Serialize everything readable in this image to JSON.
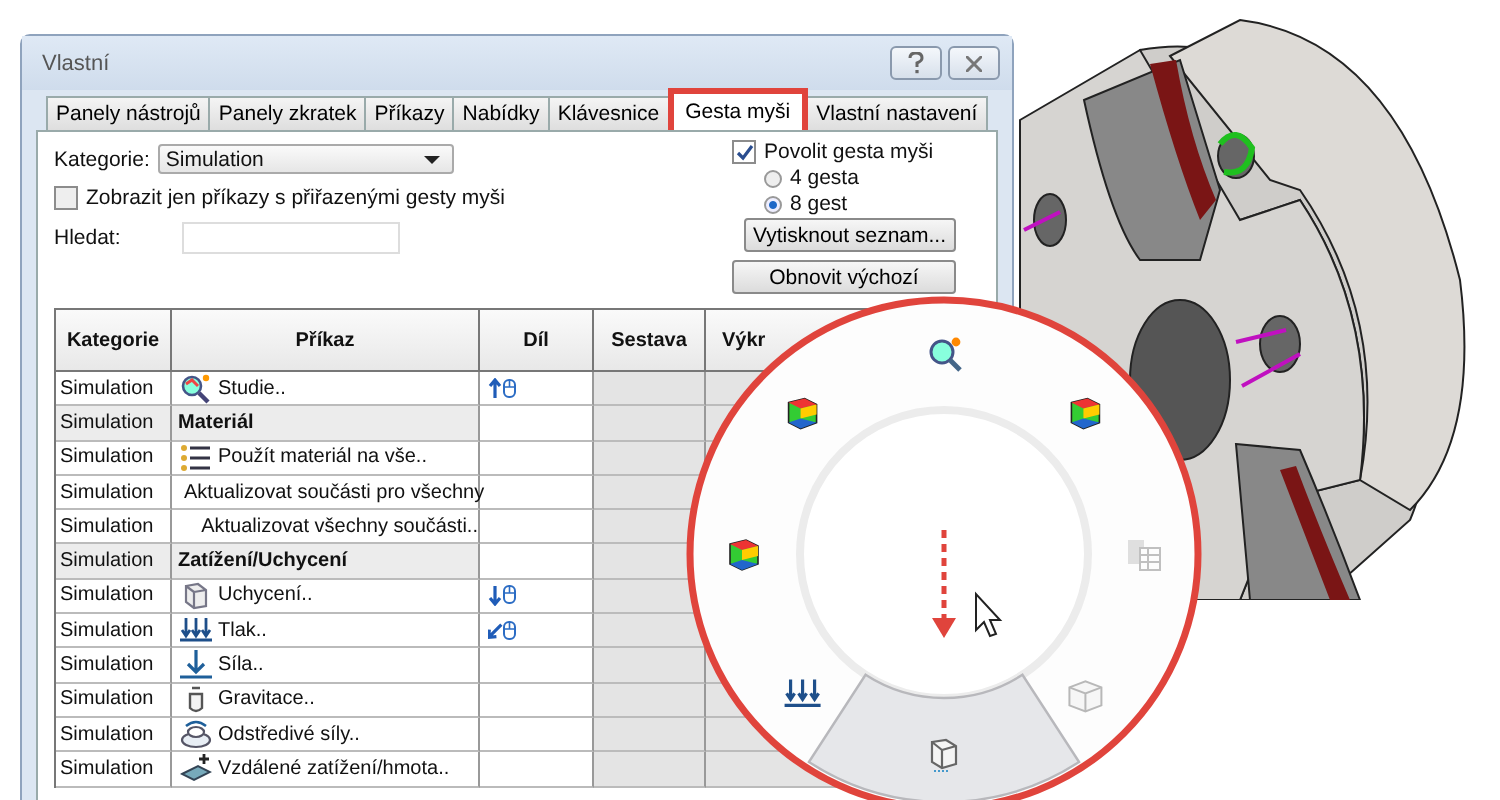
{
  "window": {
    "title": "Vlastní"
  },
  "tabs": [
    {
      "label": "Panely nástrojů",
      "selected": false
    },
    {
      "label": "Panely zkratek",
      "selected": false
    },
    {
      "label": "Příkazy",
      "selected": false
    },
    {
      "label": "Nabídky",
      "selected": false
    },
    {
      "label": "Klávesnice",
      "selected": false
    },
    {
      "label": "Gesta myši",
      "selected": true
    },
    {
      "label": "Vlastní  nastavení",
      "selected": false
    }
  ],
  "category": {
    "label": "Kategorie:",
    "value": "Simulation"
  },
  "filter_checkbox": {
    "label": "Zobrazit jen příkazy s přiřazenými gesty myši",
    "checked": false
  },
  "search": {
    "label": "Hledat:"
  },
  "enable_checkbox": {
    "label": "Povolit gesta myši",
    "checked": true
  },
  "gesture_count": [
    {
      "label": "4 gesta",
      "selected": false
    },
    {
      "label": "8 gest",
      "selected": true
    }
  ],
  "buttons": [
    "Vytisknout seznam...",
    "Obnovit výchozí"
  ],
  "table": {
    "columns": [
      "Kategorie",
      "Příkaz",
      "Díl",
      "Sestava",
      "Výkr"
    ],
    "rows": [
      {
        "kind": "command",
        "category": "Simulation",
        "command": "Studie..",
        "gesture": {
          "kind": "up"
        }
      },
      {
        "kind": "group",
        "category": "Simulation",
        "command": "Materiál"
      },
      {
        "kind": "command",
        "category": "Simulation",
        "command": "Použít materiál na vše.."
      },
      {
        "kind": "command",
        "category": "Simulation",
        "command": "Aktualizovat součásti pro všechny"
      },
      {
        "kind": "command",
        "category": "Simulation",
        "command": "Aktualizovat všechny součásti.."
      },
      {
        "kind": "group",
        "category": "Simulation",
        "command": "Zatížení/Uchycení"
      },
      {
        "kind": "command",
        "category": "Simulation",
        "command": "Uchycení..",
        "gesture": {
          "kind": "down"
        }
      },
      {
        "kind": "command",
        "category": "Simulation",
        "command": "Tlak..",
        "gesture": {
          "kind": "down-left"
        }
      },
      {
        "kind": "command",
        "category": "Simulation",
        "command": "Síla.."
      },
      {
        "kind": "command",
        "category": "Simulation",
        "command": "Gravitace.."
      },
      {
        "kind": "command",
        "category": "Simulation",
        "command": "Odstředivé síly.."
      },
      {
        "kind": "command",
        "category": "Simulation",
        "command": "Vzdálené zatížení/hmota.."
      }
    ]
  },
  "pie_menu": {
    "slots": [
      {
        "selected": false,
        "disabled": false
      },
      {
        "selected": false,
        "disabled": false
      },
      {
        "selected": false,
        "disabled": true
      },
      {
        "selected": false,
        "disabled": true
      },
      {
        "selected": true,
        "disabled": false
      },
      {
        "selected": false,
        "disabled": false
      },
      {
        "selected": false,
        "disabled": false
      },
      {
        "selected": false,
        "disabled": false
      }
    ]
  }
}
